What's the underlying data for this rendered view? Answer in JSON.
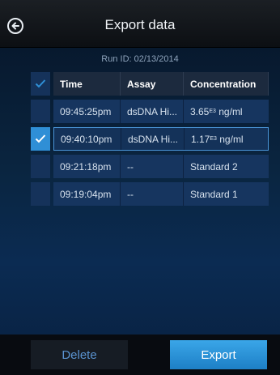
{
  "header": {
    "title": "Export data"
  },
  "run_id": "Run ID: 02/13/2014",
  "columns": [
    "Time",
    "Assay",
    "Concentration"
  ],
  "rows": [
    {
      "time": "09:45:25pm",
      "assay": "dsDNA Hi...",
      "conc_value": "3.65",
      "conc_exp": "E3",
      "conc_unit": " ng/ml",
      "checked": false
    },
    {
      "time": "09:40:10pm",
      "assay": "dsDNA Hi...",
      "conc_value": "1.17",
      "conc_exp": "E3",
      "conc_unit": " ng/ml",
      "checked": true
    },
    {
      "time": "09:21:18pm",
      "assay": "--",
      "conc_value": "Standard 2",
      "conc_exp": "",
      "conc_unit": "",
      "checked": false
    },
    {
      "time": "09:19:04pm",
      "assay": "--",
      "conc_value": "Standard 1",
      "conc_exp": "",
      "conc_unit": "",
      "checked": false
    }
  ],
  "footer": {
    "delete_label": "Delete",
    "export_label": "Export"
  },
  "colors": {
    "accent": "#2f8fd6",
    "export_button": "#2a93d8",
    "delete_text": "#5a93d0"
  },
  "icons": {
    "back": "arrow-left-circle-icon",
    "check": "checkmark-icon"
  }
}
